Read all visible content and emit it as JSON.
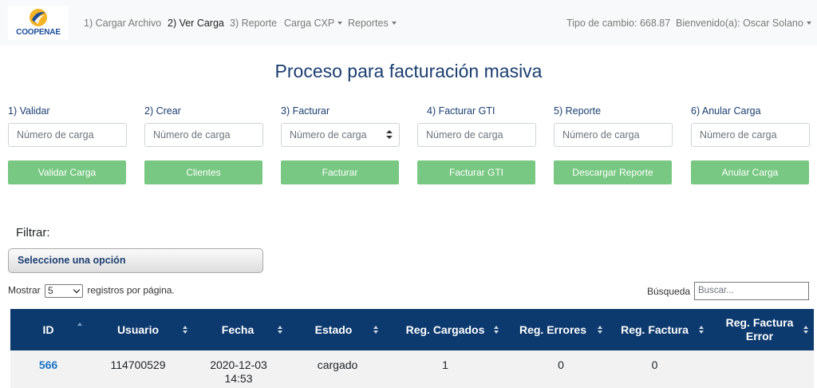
{
  "nav": {
    "logo_text": "COOPENAE",
    "items": [
      {
        "label": "1) Cargar Archivo",
        "dropdown": false,
        "active": false
      },
      {
        "label": "2) Ver Carga",
        "dropdown": false,
        "active": true
      },
      {
        "label": "3) Reporte",
        "dropdown": false,
        "active": false
      },
      {
        "label": "Carga CXP",
        "dropdown": true,
        "active": false
      },
      {
        "label": "Reportes",
        "dropdown": true,
        "active": false
      }
    ],
    "exchange_rate": "Tipo de cambio: 668.87",
    "welcome": "Bienvenido(a): Oscar Solano"
  },
  "page_title": "Proceso para facturación masiva",
  "steps": [
    {
      "label": "1) Validar",
      "placeholder": "Número de carga",
      "button": "Validar Carga"
    },
    {
      "label": "2) Crear",
      "placeholder": "Número de carga",
      "button": "Clientes"
    },
    {
      "label": "3) Facturar",
      "placeholder": "Número de carga",
      "button": "Facturar"
    },
    {
      "label": "4) Facturar GTI",
      "placeholder": "Número de carga",
      "button": "Facturar GTI"
    },
    {
      "label": "5) Reporte",
      "placeholder": "Número de carga",
      "button": "Descargar Reporte"
    },
    {
      "label": "6) Anular Carga",
      "placeholder": "Número de carga",
      "button": "Anular Carga"
    }
  ],
  "filter": {
    "label": "Filtrar:",
    "selected": "Seleccione una opción"
  },
  "table_controls": {
    "show_prefix": "Mostrar",
    "page_length": "5",
    "show_suffix": "registros por página.",
    "search_label": "Búsqueda",
    "search_placeholder": "Buscar..."
  },
  "table": {
    "headers": [
      "ID",
      "Usuario",
      "Fecha",
      "Estado",
      "Reg. Cargados",
      "Reg. Errores",
      "Reg. Factura",
      "Reg. Factura Error"
    ],
    "rows": [
      {
        "id": "566",
        "usuario": "114700529",
        "fecha": "2020-12-03 14:53",
        "estado": "cargado",
        "cargados": "1",
        "errores": "0",
        "factura": "0",
        "factura_error": ""
      }
    ]
  },
  "colors": {
    "navbar_bg": "#f8f9fa",
    "title": "#1b3e70",
    "button_green": "#78c883",
    "table_header": "#0d3a6e",
    "link": "#1a73c8"
  }
}
